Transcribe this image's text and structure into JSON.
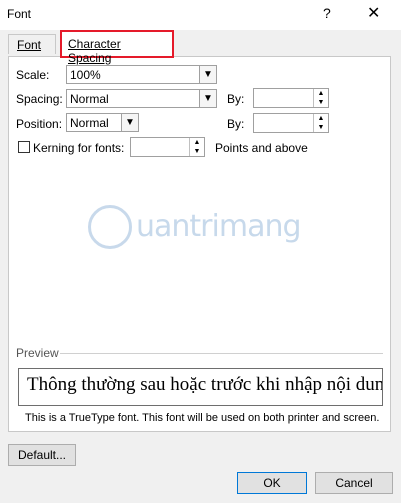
{
  "window": {
    "title": "Font",
    "help_glyph": "?",
    "close_glyph": "✕"
  },
  "tabs": [
    {
      "label": "Font",
      "active": false
    },
    {
      "label": "Character Spacing",
      "active": true
    }
  ],
  "fields": {
    "scale": {
      "label": "Scale:",
      "value": "100%"
    },
    "spacing": {
      "label": "Spacing:",
      "value": "Normal",
      "by_label": "By:",
      "by_value": ""
    },
    "position": {
      "label": "Position:",
      "value": "Normal",
      "by_label": "By:",
      "by_value": ""
    },
    "kerning": {
      "label": "Kerning for fonts:",
      "checked": false,
      "value": "",
      "suffix": "Points and above"
    }
  },
  "preview": {
    "label": "Preview",
    "text": "Thông thường sau hoặc trước khi nhập nội dun",
    "note": "This is a TrueType font. This font will be used on both printer and screen."
  },
  "watermark": {
    "text": "uantrimang"
  },
  "buttons": {
    "default": "Default...",
    "ok": "OK",
    "cancel": "Cancel"
  },
  "icons": {
    "dropdown": "chevron-down-icon",
    "spin_up": "spin-up-icon",
    "spin_down": "spin-down-icon"
  },
  "colors": {
    "highlight": "#e51a2a",
    "ok_border": "#0078d7"
  }
}
